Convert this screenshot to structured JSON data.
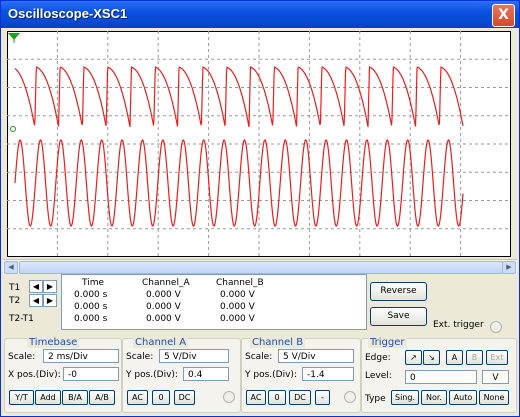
{
  "window": {
    "title": "Oscilloscope-XSC1",
    "close_label": "X"
  },
  "colors": {
    "trace": "#e62020",
    "grid": "#9a9a9a",
    "border": "#000000"
  },
  "traces": {
    "channel_a_shape": "sawtooth-decay",
    "channel_b_shape": "sine",
    "cursor_marker": "green-triangle"
  },
  "cursors": {
    "t1": "T1",
    "t2": "T2",
    "t2_t1": "T2-T1"
  },
  "readout": {
    "headers": [
      "Time",
      "Channel_A",
      "Channel_B"
    ],
    "rows": [
      [
        "0.000 s",
        "0.000 V",
        "0.000 V"
      ],
      [
        "0.000 s",
        "0.000 V",
        "0.000 V"
      ],
      [
        "0.000 s",
        "0.000 V",
        "0.000 V"
      ]
    ]
  },
  "buttons": {
    "reverse": "Reverse",
    "save": "Save",
    "ext_trigger": "Ext. trigger"
  },
  "timebase": {
    "title": "Timebase",
    "scale_label": "Scale:",
    "scale_value": "2 ms/Div",
    "xpos_label": "X pos.(Div):",
    "xpos_value": "-0",
    "modes": [
      "Y/T",
      "Add",
      "B/A",
      "A/B"
    ]
  },
  "channel_a": {
    "title": "Channel A",
    "scale_label": "Scale:",
    "scale_value": "5  V/Div",
    "ypos_label": "Y pos.(Div):",
    "ypos_value": "0.4",
    "coupling": [
      "AC",
      "0",
      "DC"
    ]
  },
  "channel_b": {
    "title": "Channel B",
    "scale_label": "Scale:",
    "scale_value": "5  V/Div",
    "ypos_label": "Y pos.(Div):",
    "ypos_value": "-1.4",
    "coupling": [
      "AC",
      "0",
      "DC",
      "-"
    ]
  },
  "trigger": {
    "title": "Trigger",
    "edge_label": "Edge:",
    "level_label": "Level:",
    "level_value": "0",
    "level_unit": "V",
    "sources": [
      "A",
      "B",
      "Ext"
    ],
    "type_label": "Type",
    "types": [
      "Sing.",
      "Nor.",
      "Auto",
      "None"
    ]
  }
}
